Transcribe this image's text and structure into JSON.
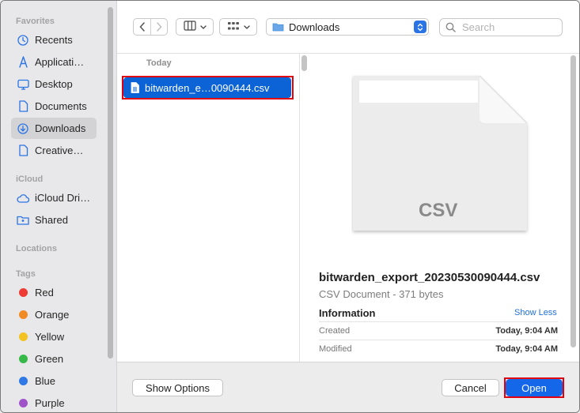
{
  "sidebar": {
    "favorites_header": "Favorites",
    "favorites": [
      {
        "label": "Recents",
        "icon": "clock-icon"
      },
      {
        "label": "Applicati…",
        "icon": "applications-icon"
      },
      {
        "label": "Desktop",
        "icon": "desktop-icon"
      },
      {
        "label": "Documents",
        "icon": "document-icon"
      },
      {
        "label": "Downloads",
        "icon": "downloads-icon",
        "selected": true
      },
      {
        "label": "Creative…",
        "icon": "document-icon"
      }
    ],
    "icloud_header": "iCloud",
    "icloud": [
      {
        "label": "iCloud Dri…",
        "icon": "cloud-icon"
      },
      {
        "label": "Shared",
        "icon": "shared-folder-icon"
      }
    ],
    "locations_header": "Locations",
    "tags_header": "Tags",
    "tags": [
      {
        "label": "Red",
        "color": "#ee3b34"
      },
      {
        "label": "Orange",
        "color": "#f08a24"
      },
      {
        "label": "Yellow",
        "color": "#f2c321"
      },
      {
        "label": "Green",
        "color": "#37b94a"
      },
      {
        "label": "Blue",
        "color": "#2f78e6"
      },
      {
        "label": "Purple",
        "color": "#a053c9"
      }
    ]
  },
  "toolbar": {
    "back_icon": "chevron-left-icon",
    "forward_icon": "chevron-right-icon",
    "view_icon": "column-view-icon",
    "group_icon": "grid-icon",
    "location": "Downloads",
    "search_placeholder": "Search"
  },
  "column": {
    "header": "Today",
    "selected_file": "bitwarden_e…0090444.csv"
  },
  "preview": {
    "thumbnail_label": "CSV",
    "filename": "bitwarden_export_20230530090444.csv",
    "kind": "CSV Document - 371 bytes",
    "info_header": "Information",
    "show_less": "Show Less",
    "rows": [
      {
        "label": "Created",
        "value": "Today, 9:04 AM"
      },
      {
        "label": "Modified",
        "value": "Today, 9:04 AM"
      }
    ]
  },
  "footer": {
    "show_options": "Show Options",
    "cancel": "Cancel",
    "open": "Open"
  },
  "colors": {
    "accent": "#1467e8",
    "highlight_outline": "#e00012"
  }
}
